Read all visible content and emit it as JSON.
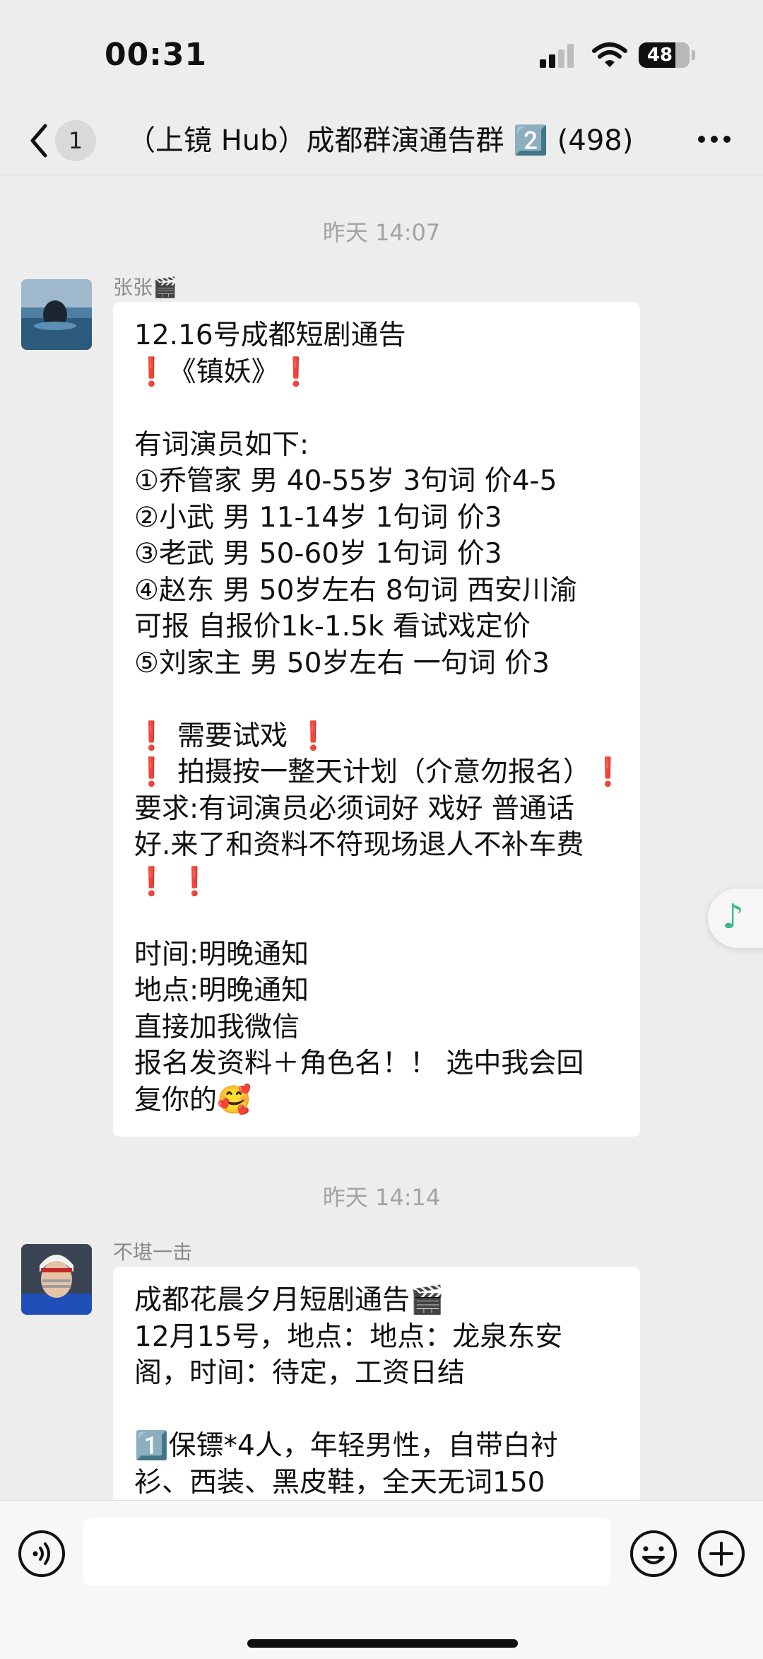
{
  "status_bar": {
    "time": "00:31",
    "battery": "48"
  },
  "header": {
    "unread_count": "1",
    "title": "（上镜 Hub）成都群演通告群 2️⃣ (498)"
  },
  "messages": [
    {
      "time": "昨天 14:07",
      "sender": "张张🎬",
      "lines": [
        "12.16号成都短剧通告",
        "❗《镇妖》❗",
        "",
        "有词演员如下:",
        "①乔管家 男 40-55岁 3句词 价4-5",
        "②小武 男 11-14岁 1句词 价3",
        "③老武 男 50-60岁 1句词 价3",
        "④赵东 男 50岁左右 8句词 西安川渝",
        "可报 自报价1k-1.5k 看试戏定价",
        "⑤刘家主 男 50岁左右 一句词 价3",
        "",
        "❗ 需要试戏 ❗",
        "❗ 拍摄按一整天计划（介意勿报名）❗",
        "要求:有词演员必须词好 戏好 普通话",
        "好.来了和资料不符现场退人不补车费",
        "❗ ❗",
        "",
        "时间:明晚通知",
        "地点:明晚通知",
        "直接加我微信",
        "报名发资料＋角色名！！ 选中我会回",
        "复你的🥰"
      ]
    },
    {
      "time": "昨天 14:14",
      "sender": "不堪一击",
      "lines": [
        "成都花晨夕月短剧通告🎬",
        "12月15号，地点：地点：龙泉东安",
        "阁，时间：待定，工资日结",
        "",
        "1️⃣保镖*4人，年轻男性，自带白衬",
        "衫、西装、黑皮鞋，全天无词150"
      ]
    }
  ],
  "icons": {
    "back": "chevron-left-icon",
    "more": "more-dots-icon",
    "music": "music-note-icon",
    "voice": "voice-icon",
    "emoji": "emoji-icon",
    "plus": "plus-icon"
  },
  "colors": {
    "background": "#ededed",
    "bubble": "#ffffff",
    "alert": "#e0242b",
    "music_accent": "#3dbb82"
  }
}
